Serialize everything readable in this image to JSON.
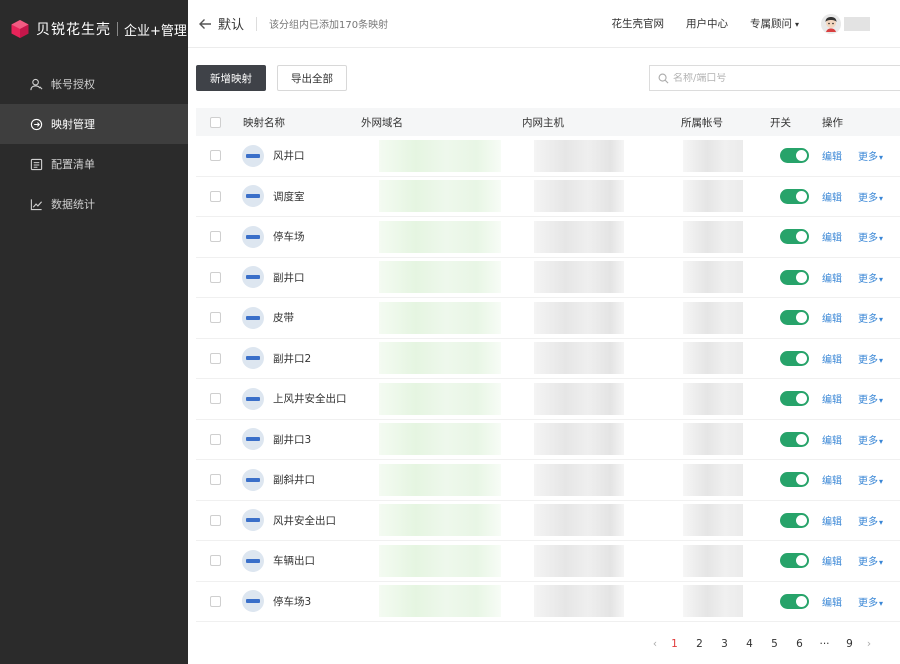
{
  "brand": {
    "name": "贝锐花生壳",
    "edition": "企业+管理",
    "logo_color": "#e8245a"
  },
  "sidebar": {
    "items": [
      {
        "label": "帐号授权",
        "icon": "user-icon",
        "active": false
      },
      {
        "label": "映射管理",
        "icon": "mapping-icon",
        "active": true
      },
      {
        "label": "配置清单",
        "icon": "list-icon",
        "active": false
      },
      {
        "label": "数据统计",
        "icon": "chart-icon",
        "active": false
      }
    ]
  },
  "header": {
    "group_name": "默认",
    "group_info": "该分组内已添加170条映射",
    "links": {
      "official_site": "花生壳官网",
      "user_center": "用户中心",
      "consultant": "专属顾问"
    }
  },
  "toolbar": {
    "add_label": "新增映射",
    "export_label": "导出全部",
    "search_placeholder": "名称/端口号"
  },
  "table": {
    "columns": {
      "name": "映射名称",
      "wan": "外网域名",
      "lan": "内网主机",
      "account": "所属帐号",
      "switch": "开关",
      "ops": "操作"
    },
    "edit_label": "编辑",
    "more_label": "更多",
    "rows": [
      {
        "name": "风井口",
        "enabled": true
      },
      {
        "name": "调度室",
        "enabled": true
      },
      {
        "name": "停车场",
        "enabled": true
      },
      {
        "name": "副井口",
        "enabled": true
      },
      {
        "name": "皮带",
        "enabled": true
      },
      {
        "name": "副井口2",
        "enabled": true
      },
      {
        "name": "上风井安全出口",
        "enabled": true
      },
      {
        "name": "副井口3",
        "enabled": true
      },
      {
        "name": "副斜井口",
        "enabled": true
      },
      {
        "name": "风井安全出口",
        "enabled": true
      },
      {
        "name": "车辆出口",
        "enabled": true
      },
      {
        "name": "停车场3",
        "enabled": true
      }
    ]
  },
  "pagination": {
    "prev": "‹",
    "pages": [
      "1",
      "2",
      "3",
      "4",
      "5",
      "6",
      "···",
      "9"
    ],
    "current": "1",
    "next": "›"
  },
  "colors": {
    "sidebar_bg": "#2b2b2b",
    "toggle_on": "#27a36a",
    "link": "#3a87d6",
    "active_page": "#e03b3b"
  }
}
